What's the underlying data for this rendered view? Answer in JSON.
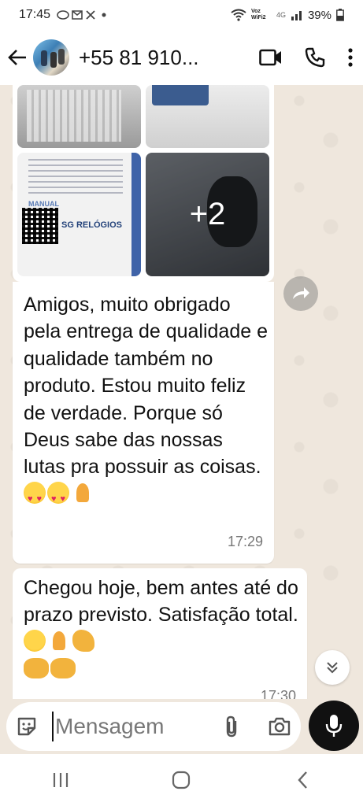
{
  "status_bar": {
    "time": "17:45",
    "carrier": "Voz WiFi2",
    "network": "4G",
    "battery": "39%"
  },
  "header": {
    "contact_name": "+55 81 910..."
  },
  "chat": {
    "media_more_count": "+2",
    "media_card_brand": "SG RELÓGIOS",
    "media_card_manual": "MANUAL",
    "messages": [
      {
        "text": "Amigos, muito obrigado pela entrega de qualidade e qualidade também no produto. Estou muito feliz de verdade. Porque só Deus sabe das nossas lutas pra possuir as coisas.",
        "time": "17:29"
      },
      {
        "text": "Chegou hoje, bem antes até do prazo previsto. Satisfação total.",
        "time": "17:30"
      }
    ]
  },
  "input": {
    "placeholder": "Mensagem"
  },
  "icons": {
    "back": "back-arrow-icon",
    "video": "video-call-icon",
    "call": "phone-icon",
    "menu": "more-vert-icon",
    "forward": "forward-icon",
    "scroll": "double-chevron-down-icon",
    "emoji": "sticker-icon",
    "attach": "paperclip-icon",
    "camera": "camera-icon",
    "mic": "mic-icon"
  },
  "colors": {
    "chat_bg": "#efe7dd",
    "bubble": "#ffffff",
    "mic_button": "#111111"
  }
}
